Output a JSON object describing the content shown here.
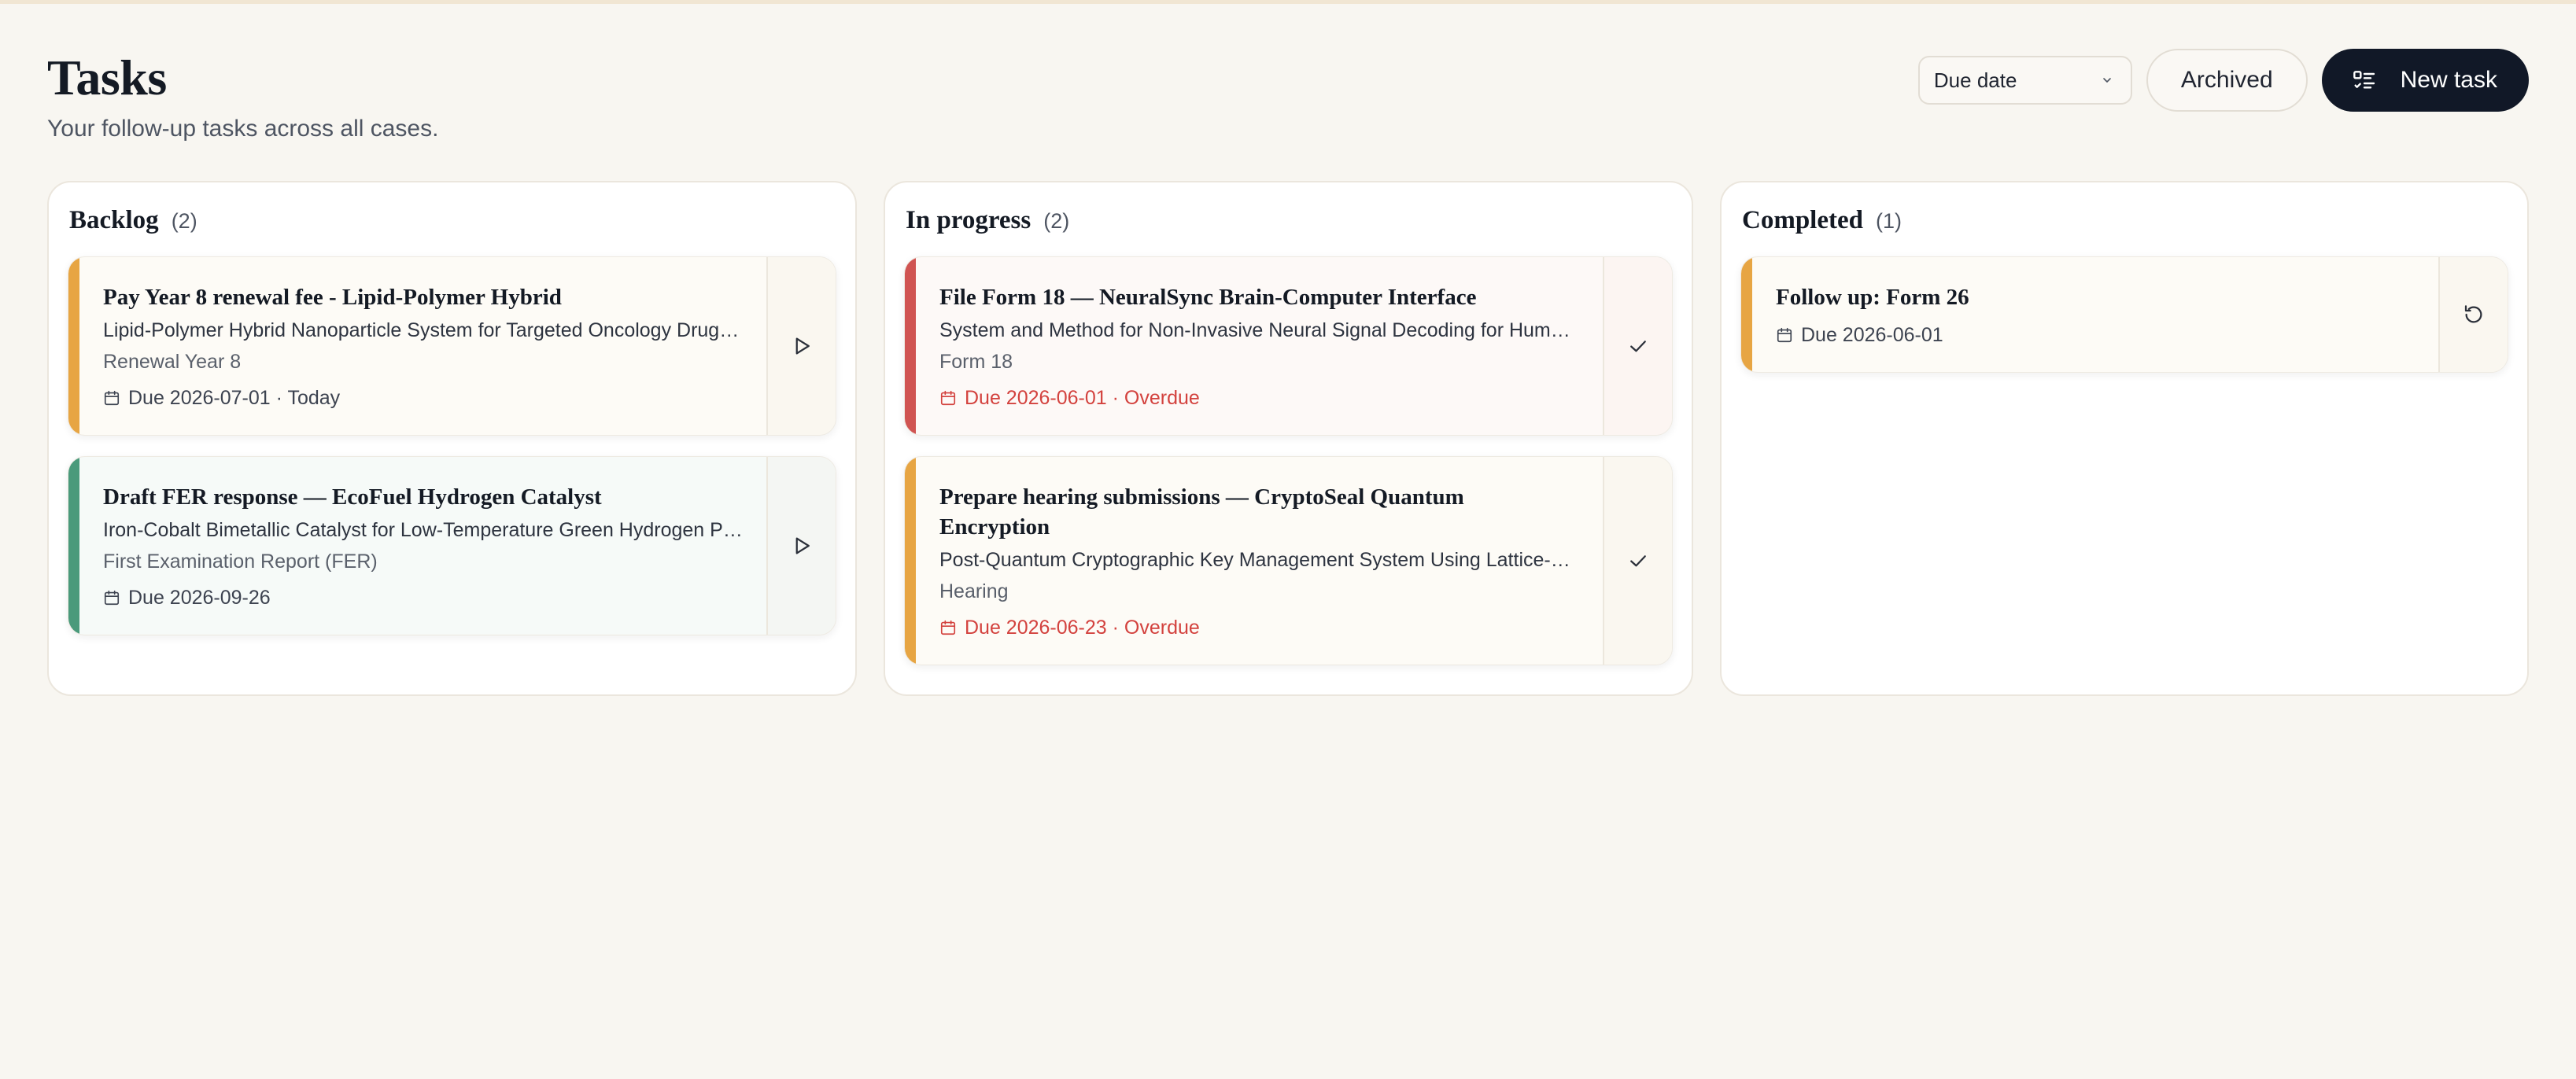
{
  "page": {
    "title": "Tasks",
    "subtitle": "Your follow-up tasks across all cases."
  },
  "toolbar": {
    "sort_value": "Due date",
    "archived_label": "Archived",
    "new_task_label": "New task"
  },
  "colors": {
    "accent_dark": "#111827",
    "amber": "#e7a543",
    "green": "#4a9a7b",
    "red": "#d05452",
    "overdue_text": "#d3423e"
  },
  "columns": [
    {
      "title": "Backlog",
      "count": "(2)",
      "cards": [
        {
          "title": "Pay Year 8 renewal fee - Lipid-Polymer Hybrid",
          "description": "Lipid-Polymer Hybrid Nanoparticle System for Targeted Oncology Drug Delivery",
          "type": "Renewal Year 8",
          "due": "Due 2026-07-01 · Today",
          "color": "amber",
          "action_icon": "play-icon"
        },
        {
          "title": "Draft FER response — EcoFuel Hydrogen Catalyst",
          "description": "Iron-Cobalt Bimetallic Catalyst for Low-Temperature Green Hydrogen Production",
          "type": "First Examination Report (FER)",
          "due": "Due 2026-09-26",
          "color": "green",
          "action_icon": "play-icon"
        }
      ]
    },
    {
      "title": "In progress",
      "count": "(2)",
      "cards": [
        {
          "title": "File Form 18 — NeuralSync Brain-Computer Interface",
          "description": "System and Method for Non-Invasive Neural Signal Decoding for Human-Computer Interaction",
          "type": "Form 18",
          "due": "Due 2026-06-01 · Overdue",
          "color": "red",
          "action_icon": "check-icon"
        },
        {
          "title": "Prepare hearing submissions — CryptoSeal Quantum Encryption",
          "description": "Post-Quantum Cryptographic Key Management System Using Lattice-Based Encryption",
          "type": "Hearing",
          "due": "Due 2026-06-23 · Overdue",
          "color": "amber",
          "action_icon": "check-icon"
        }
      ]
    },
    {
      "title": "Completed",
      "count": "(1)",
      "cards": [
        {
          "title": "Follow up: Form 26",
          "due": "Due 2026-06-01",
          "color": "amber",
          "action_icon": "undo-icon"
        }
      ]
    }
  ]
}
